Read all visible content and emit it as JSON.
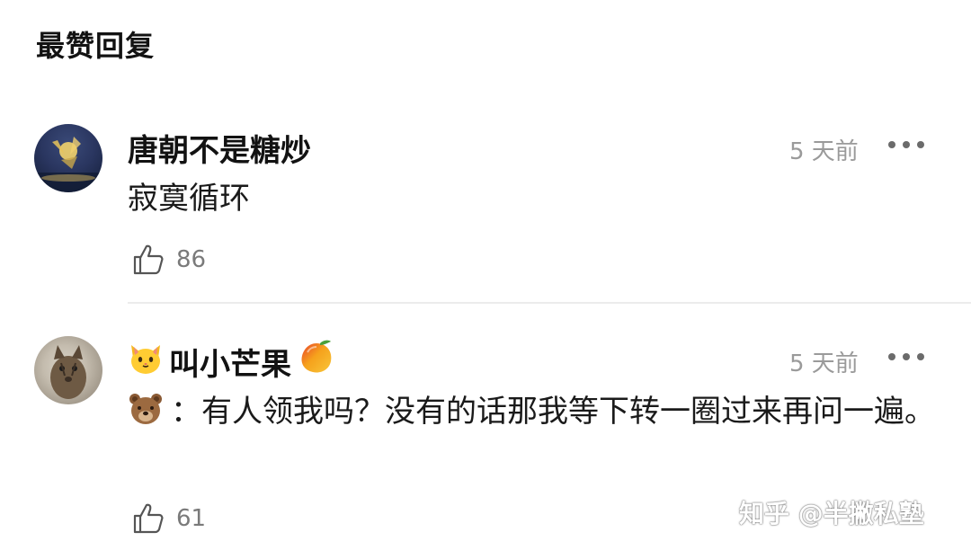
{
  "section": {
    "title": "最赞回复"
  },
  "comments": [
    {
      "author": "唐朝不是糖炒",
      "time": "5 天前",
      "content": "寂寞循环",
      "likes": "86",
      "avatar_icon": "avatar-night-sky-icon"
    },
    {
      "author": "叫小芒果",
      "author_prefix_icon": "cat-face-emoji-icon",
      "author_suffix_icon": "mango-emoji-icon",
      "time": "5 天前",
      "content_prefix_icon": "bear-face-emoji-icon",
      "content": "：有人领我吗？没有的话那我等下转一圈过来再问一遍。",
      "likes": "61",
      "avatar_icon": "avatar-cat-photo-icon"
    }
  ],
  "watermark": {
    "text": "知乎 @半撇私塾"
  },
  "colors": {
    "text_primary": "#121212",
    "text_secondary": "#9a9a9a",
    "divider": "#ececec"
  }
}
